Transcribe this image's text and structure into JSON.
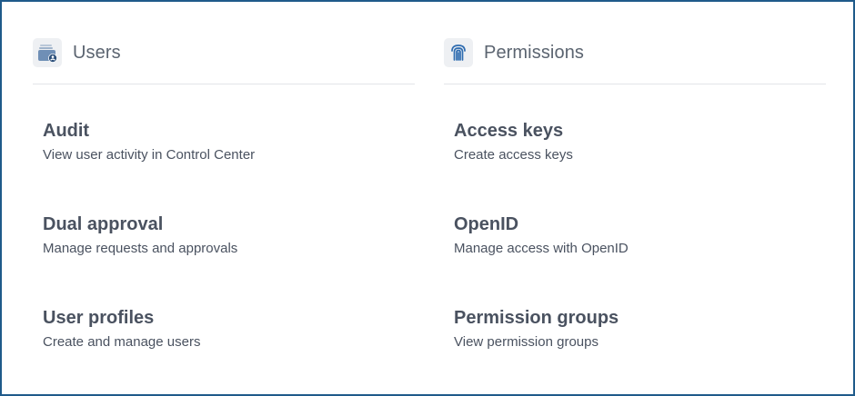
{
  "users": {
    "title": "Users",
    "icon": "user-folder-icon",
    "items": [
      {
        "title": "Audit",
        "description": "View user activity in Control Center"
      },
      {
        "title": "Dual approval",
        "description": "Manage requests and approvals"
      },
      {
        "title": "User profiles",
        "description": "Create and manage users"
      }
    ]
  },
  "permissions": {
    "title": "Permissions",
    "icon": "fingerprint-icon",
    "items": [
      {
        "title": "Access keys",
        "description": "Create access keys"
      },
      {
        "title": "OpenID",
        "description": "Manage access with OpenID"
      },
      {
        "title": "Permission groups",
        "description": "View permission groups"
      }
    ]
  },
  "colors": {
    "frame_border": "#1f5a8a",
    "icon_accent": "#2f6cb0",
    "text": "#4a5260",
    "divider": "#e2e5e9"
  }
}
